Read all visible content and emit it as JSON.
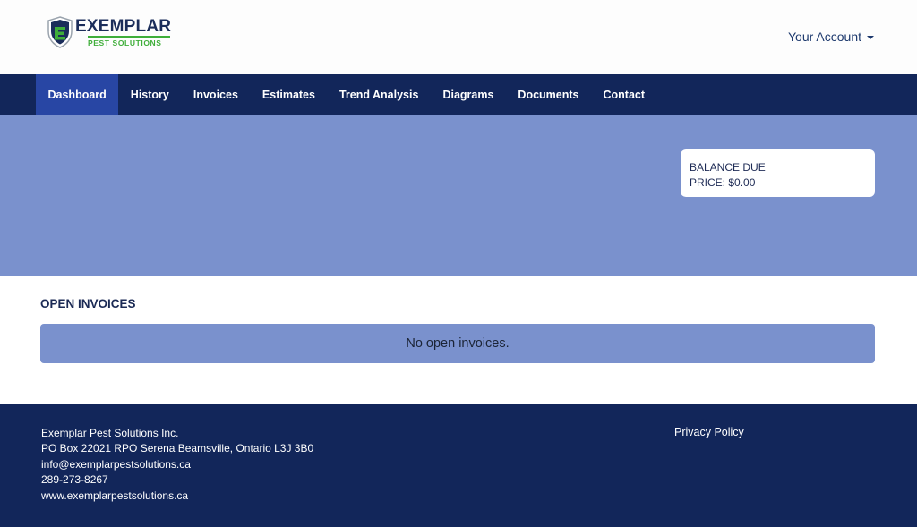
{
  "brand": {
    "name": "EXEMPLAR",
    "tagline": "PEST SOLUTIONS",
    "colors": {
      "navy": "#12265a",
      "green": "#3fae3a",
      "hero": "#7a91cd",
      "active_tab": "#2846a4"
    }
  },
  "account": {
    "label": "Your Account",
    "icon": "chevron-down-icon"
  },
  "nav": {
    "items": [
      {
        "label": "Dashboard",
        "active": true
      },
      {
        "label": "History"
      },
      {
        "label": "Invoices"
      },
      {
        "label": "Estimates"
      },
      {
        "label": "Trend Analysis"
      },
      {
        "label": "Diagrams"
      },
      {
        "label": "Documents"
      },
      {
        "label": "Contact"
      }
    ]
  },
  "balance": {
    "heading": "BALANCE DUE",
    "price_line": "PRICE: $0.00"
  },
  "invoices": {
    "title": "OPEN INVOICES",
    "empty_message": "No open invoices."
  },
  "footer": {
    "company": "Exemplar Pest Solutions Inc.",
    "address": "PO Box 22021 RPO Serena Beamsville, Ontario L3J 3B0",
    "email": "info@exemplarpestsolutions.ca",
    "phone": "289-273-8267",
    "website": "www.exemplarpestsolutions.ca",
    "privacy": "Privacy Policy"
  }
}
